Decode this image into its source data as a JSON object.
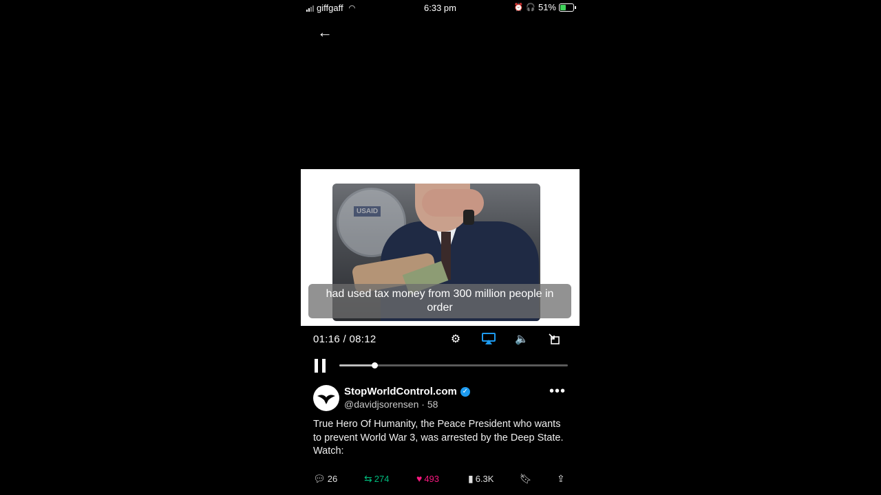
{
  "status_bar": {
    "carrier": "giffgaff",
    "time": "6:33 pm",
    "battery": "51%",
    "battery_level": 0.51
  },
  "nav": {
    "back_icon": "arrow-left-icon"
  },
  "video": {
    "caption": "had used tax money from 300 million people in order",
    "seal_text": "USAID",
    "current_time": "01:16",
    "separator": " / ",
    "duration": "08:12",
    "progress": 0.155
  },
  "controls": {
    "settings_icon": "gear-icon",
    "airplay_icon": "airplay-icon",
    "volume_icon": "speaker-icon",
    "exit_icon": "exit-fullscreen-icon"
  },
  "post": {
    "author_name": "StopWorldControl.com",
    "handle": "@davidjsorensen",
    "time_fragment": "· 58",
    "text": "True Hero Of Humanity, the Peace President who wants to prevent World War 3, was arrested by the Deep State. Watch:",
    "replies": "26",
    "reposts": "274",
    "likes": "493",
    "views": "6.3K",
    "colors": {
      "verified": "#1d9bf0",
      "repost": "#00ba7c",
      "like": "#f91880"
    }
  }
}
